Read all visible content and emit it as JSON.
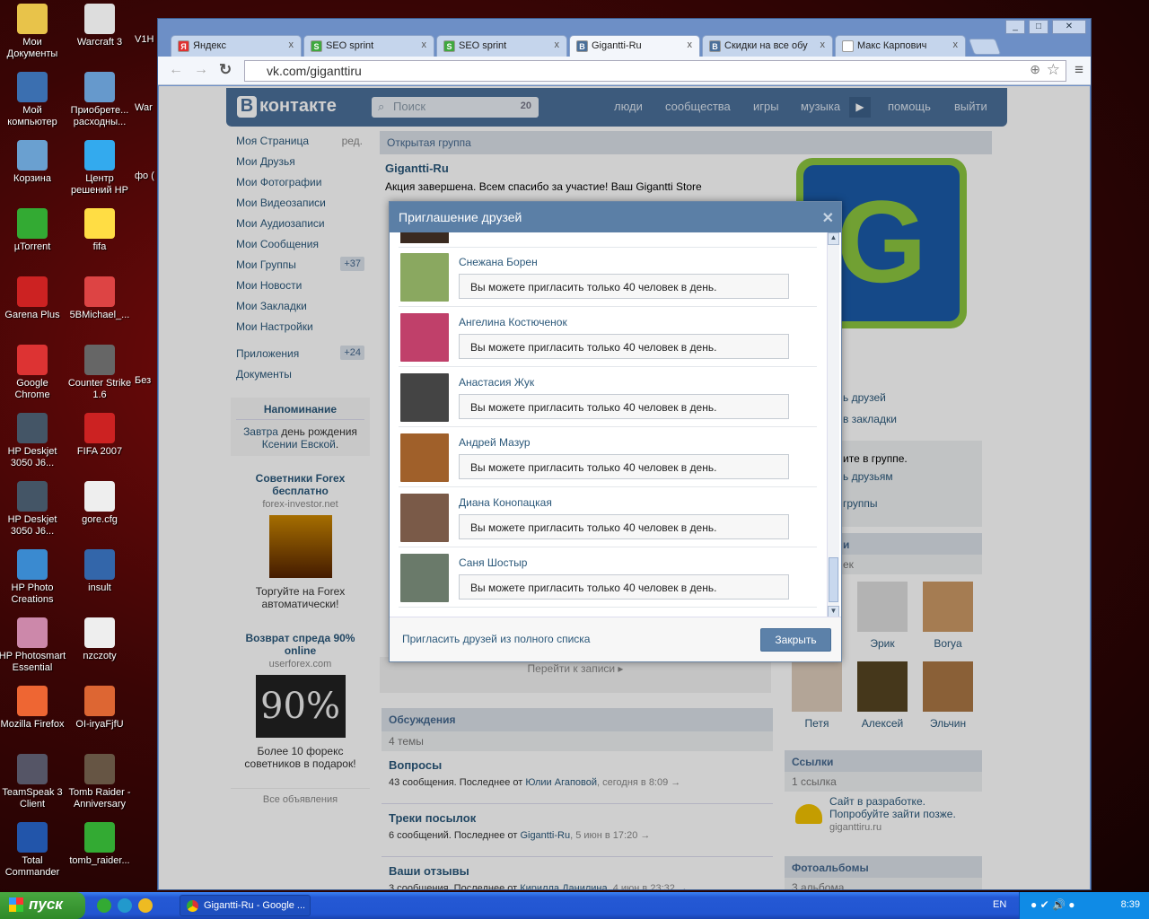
{
  "desktop": {
    "col1": [
      "Мои Документы",
      "Мой компьютер",
      "Корзина",
      "µTorrent",
      "Garena Plus",
      "Google Chrome",
      "HP Deskjet 3050 J6...",
      "HP Deskjet 3050 J6...",
      "HP Photo Creations",
      "HP Photosmart Essential",
      "Mozilla Firefox",
      "TeamSpeak 3 Client",
      "Total Commander"
    ],
    "col2": [
      "Warcraft 3",
      "Приобрете... расходны...",
      "Центр решений HP",
      "fifa",
      "5BMichael_...",
      "Counter Strike 1.6",
      "FIFA 2007",
      "gore.cfg",
      "insult",
      "nzczoty",
      "OI-iryaFjfU",
      "Tomb Raider - Anniversary",
      "tomb_raider..."
    ],
    "col3": [
      "V1H",
      "War",
      "фо (",
      "Без"
    ]
  },
  "browser": {
    "tabs": [
      {
        "label": "Яндекс",
        "icon": "Я",
        "color": "#e03030"
      },
      {
        "label": "SEO sprint",
        "icon": "S",
        "color": "#3fa83f"
      },
      {
        "label": "SEO sprint",
        "icon": "S",
        "color": "#3fa83f"
      },
      {
        "label": "Gigantti-Ru",
        "icon": "B",
        "color": "#4a6f99"
      },
      {
        "label": "Скидки на все обу",
        "icon": "B",
        "color": "#4a6f99"
      },
      {
        "label": "Макс Карпович",
        "icon": "",
        "color": "#ffffff"
      }
    ],
    "url": "vk.com/giganttiru"
  },
  "vk": {
    "logo": "контакте",
    "logo_letter": "В",
    "search_placeholder": "Поиск",
    "search_count": "20",
    "nav": [
      "люди",
      "сообщества",
      "игры",
      "музыка",
      "помощь",
      "выйти"
    ],
    "menu": [
      {
        "label": "Моя Страница",
        "extra": "ред."
      },
      {
        "label": "Мои Друзья"
      },
      {
        "label": "Мои Фотографии"
      },
      {
        "label": "Мои Видеозаписи"
      },
      {
        "label": "Мои Аудиозаписи"
      },
      {
        "label": "Мои Сообщения"
      },
      {
        "label": "Мои Группы",
        "count": "+37"
      },
      {
        "label": "Мои Новости"
      },
      {
        "label": "Мои Закладки"
      },
      {
        "label": "Мои Настройки"
      },
      {
        "label": "Приложения",
        "count": "+24"
      },
      {
        "label": "Документы"
      }
    ],
    "reminder": {
      "title": "Напоминание",
      "a": "Завтра",
      "b": " день рождения ",
      "c": "Ксении Евской",
      "d": "."
    },
    "ads": [
      {
        "title": "Советники Forex бесплатно",
        "domain": "forex-investor.net",
        "text": "Торгуйте на Forex автоматически!"
      },
      {
        "title": "Возврат спреда 90% online",
        "domain": "userforex.com",
        "text": "Более 10 форекс советников в подарок!",
        "img_text": "90%"
      }
    ],
    "all_ads": "Все объявления",
    "group": {
      "type": "Открытая группа",
      "name": "Gigantti-Ru",
      "status": "Акция завершена. Всем спасибо за участие! Ваш Gigantti Store",
      "goto": "Перейти к записи ▸"
    },
    "right": {
      "invite": "ь друзей",
      "bookmarks": "в закладки",
      "member": "ите в группе.",
      "tell": "ь друзьям",
      "leave": "группы",
      "members_hdr": "и",
      "members_sub": "ек",
      "members": [
        "",
        "Эрик",
        "Borya",
        "Петя",
        "Алексей",
        "Эльчин"
      ],
      "links_hdr": "Ссылки",
      "links_sub": "1 ссылка",
      "link_title": "Сайт в разработке. Попробуйте зайти позже.",
      "link_domain": "giganttiru.ru",
      "albums_hdr": "Фотоальбомы",
      "albums_sub": "3 альбома"
    },
    "discussions": {
      "title": "Обсуждения",
      "count": "4 темы",
      "topics": [
        {
          "title": "Вопросы",
          "a": "43 сообщения. Последнее от ",
          "who": "Юлии Агаповой",
          "when": ", сегодня в 8:09 →"
        },
        {
          "title": "Треки посылок",
          "a": "6 сообщений. Последнее от ",
          "who": "Gigantti-Ru",
          "when": ", 5 июн в 17:20 →"
        },
        {
          "title": "Ваши отзывы",
          "a": "3 сообщения. Последнее от ",
          "who": "Кирилла Данилина",
          "when": ", 4 июн в 23:32 →"
        }
      ]
    }
  },
  "modal": {
    "title": "Приглашение друзей",
    "friends": [
      {
        "name": "Снежана Борен",
        "msg": "Вы можете пригласить только 40 человек в день.",
        "color": "#8aa860"
      },
      {
        "name": "Ангелина Костюченок",
        "msg": "Вы можете пригласить только 40 человек в день.",
        "color": "#c0406a"
      },
      {
        "name": "Анастасия Жук",
        "msg": "Вы можете пригласить только 40 человек в день.",
        "color": "#444"
      },
      {
        "name": "Андрей Мазур",
        "msg": "Вы можете пригласить только 40 человек в день.",
        "color": "#a0602a"
      },
      {
        "name": "Диана Конопацкая",
        "msg": "Вы можете пригласить только 40 человек в день.",
        "color": "#7a5a48"
      },
      {
        "name": "Саня Шостыр",
        "msg": "Вы можете пригласить только 40 человек в день.",
        "color": "#6a7a6a"
      }
    ],
    "full_list": "Пригласить друзей из полного списка",
    "close": "Закрыть"
  },
  "taskbar": {
    "start": "пуск",
    "task": "Gigantti-Ru - Google ...",
    "lang": "EN",
    "time": "8:39"
  }
}
